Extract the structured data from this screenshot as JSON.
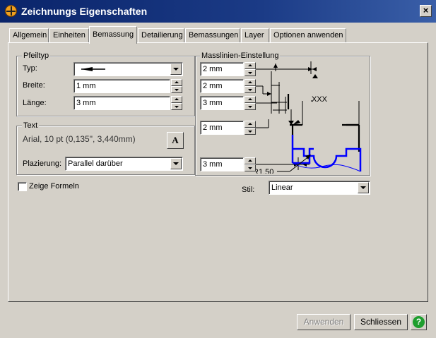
{
  "window": {
    "title": "Zeichnungs Eigenschaften",
    "close_label": "×"
  },
  "tabs": [
    {
      "label": "Allgemein"
    },
    {
      "label": "Einheiten"
    },
    {
      "label": "Bemassung",
      "active": true
    },
    {
      "label": "Detailierung"
    },
    {
      "label": "Bemassungen"
    },
    {
      "label": "Layer"
    },
    {
      "label": "Optionen anwenden"
    }
  ],
  "pfeiltyp": {
    "title": "Pfeiltyp",
    "typ_label": "Typ:",
    "breite_label": "Breite:",
    "breite_value": "1 mm",
    "laenge_label": "Länge:",
    "laenge_value": "3 mm"
  },
  "text_group": {
    "title": "Text",
    "font_value": "Arial, 10 pt (0,135\", 3,440mm)",
    "font_button": "A",
    "plazierung_label": "Plazierung:",
    "plazierung_value": "Parallel darüber"
  },
  "zeige_formeln": {
    "label": "Zeige Formeln",
    "checked": false
  },
  "masslinien": {
    "title": "Masslinien-Einstellung",
    "spinners": [
      "2 mm",
      "2 mm",
      "3 mm",
      "2 mm",
      "3 mm"
    ],
    "diagram_xxx": "XXX",
    "diagram_radius": "R1.50"
  },
  "stil": {
    "label": "Stil:",
    "value": "Linear"
  },
  "buttons": {
    "anwenden": "Anwenden",
    "schliessen": "Schliessen",
    "help": "?"
  },
  "colors": {
    "titlebar": "#0a246a",
    "face": "#d4d0c8",
    "diagram_part": "#0000ff",
    "help": "#1e9e2e"
  }
}
